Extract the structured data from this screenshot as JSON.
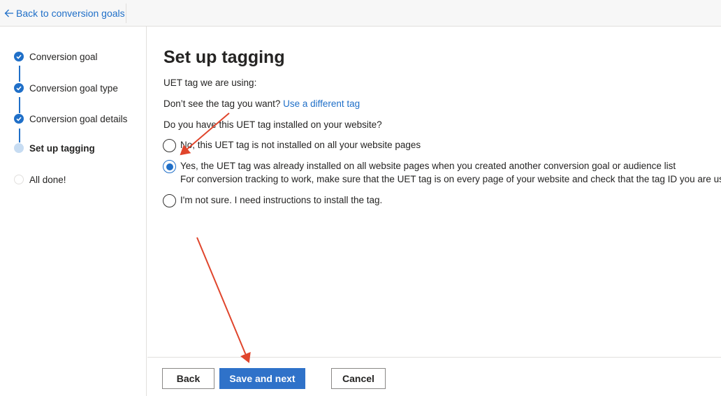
{
  "topbar": {
    "back_label": "Back to conversion goals",
    "back_icon": "arrow-left-icon"
  },
  "sidebar": {
    "steps": [
      {
        "label": "Conversion goal",
        "state": "done"
      },
      {
        "label": "Conversion goal type",
        "state": "done"
      },
      {
        "label": "Conversion goal details",
        "state": "done"
      },
      {
        "label": "Set up tagging",
        "state": "current"
      },
      {
        "label": "All done!",
        "state": "todo"
      }
    ]
  },
  "main": {
    "title": "Set up tagging",
    "uet_tag_label": "UET tag we are using:",
    "dont_see_text": "Don’t see the tag you want?",
    "use_different_tag_link": "Use a different tag",
    "question": "Do you have this UET tag installed on your website?",
    "options": [
      {
        "label": "No, this UET tag is not installed on all your website pages",
        "checked": false
      },
      {
        "label": "Yes, the UET tag was already installed on all website pages when you created another conversion goal or audience list",
        "sub": "For conversion tracking to work, make sure that the UET tag is on every page of your website and check that the tag ID you are using is",
        "checked": true
      },
      {
        "label": "I'm not sure. I need instructions to install the tag.",
        "checked": false
      }
    ]
  },
  "footer": {
    "back_label": "Back",
    "save_label": "Save and next",
    "cancel_label": "Cancel"
  },
  "colors": {
    "accent": "#1f6fc8",
    "primary_button": "#2f72c9",
    "annotation_arrow": "#e0452c"
  }
}
